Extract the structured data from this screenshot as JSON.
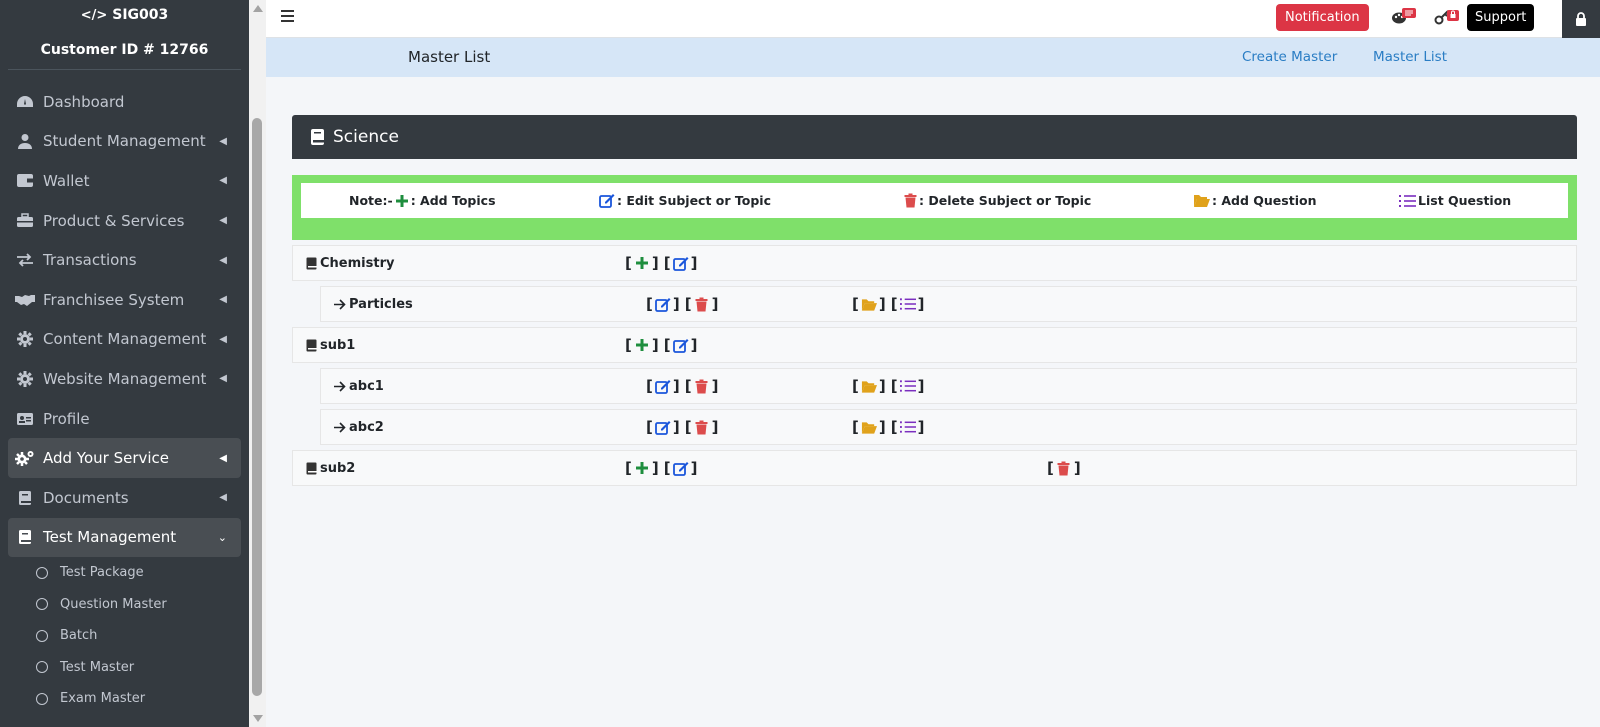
{
  "sidebar": {
    "brand": "SIG003",
    "customer_id": "Customer ID # 12766",
    "items": [
      {
        "label": "Dashboard",
        "icon": "dashboard-icon",
        "caret": false
      },
      {
        "label": "Student Management",
        "icon": "user-icon",
        "caret": true
      },
      {
        "label": "Wallet",
        "icon": "wallet-icon",
        "caret": true
      },
      {
        "label": "Product & Services",
        "icon": "toolbox-icon",
        "caret": true
      },
      {
        "label": "Transactions",
        "icon": "exchange-icon",
        "caret": true
      },
      {
        "label": "Franchisee System",
        "icon": "handshake-icon",
        "caret": true
      },
      {
        "label": "Content Management",
        "icon": "gear-icon",
        "caret": true
      },
      {
        "label": "Website Management",
        "icon": "gear-icon",
        "caret": true
      },
      {
        "label": "Profile",
        "icon": "id-card-icon",
        "caret": false
      },
      {
        "label": "Add Your Service",
        "icon": "gears-icon",
        "caret": true
      },
      {
        "label": "Documents",
        "icon": "book-icon",
        "caret": true
      },
      {
        "label": "Test Management",
        "icon": "book-icon",
        "caret": true
      }
    ],
    "sub_items": [
      "Test Package",
      "Question Master",
      "Batch",
      "Test Master",
      "Exam Master"
    ]
  },
  "topbar": {
    "notification_label": "Notification",
    "support_label": "Support"
  },
  "header": {
    "title": "Master List",
    "links": [
      "Create Master",
      "Master List"
    ]
  },
  "card": {
    "title": "Science",
    "note": {
      "prefix": "Note:-",
      "add_topics": ": Add Topics",
      "edit": ": Edit Subject or Topic",
      "delete": " : Delete Subject or Topic",
      "add_question": ": Add Question",
      "list_question": " List Question"
    },
    "rows": [
      {
        "label": "Chemistry",
        "type": "subject"
      },
      {
        "label": "Particles",
        "type": "topic"
      },
      {
        "label": "sub1",
        "type": "subject"
      },
      {
        "label": "abc1",
        "type": "topic"
      },
      {
        "label": "abc2",
        "type": "topic"
      },
      {
        "label": "sub2",
        "type": "subject"
      }
    ]
  },
  "colors": {
    "sidebar_bg": "#343a40",
    "accent_green": "#7fe06a",
    "add_green": "#1e8e3e",
    "edit_blue": "#1a56db",
    "delete_red": "#dc4c4c",
    "folder_yellow": "#e0a21b",
    "list_purple": "#7b2fbf",
    "notification_red": "#dc3545"
  }
}
